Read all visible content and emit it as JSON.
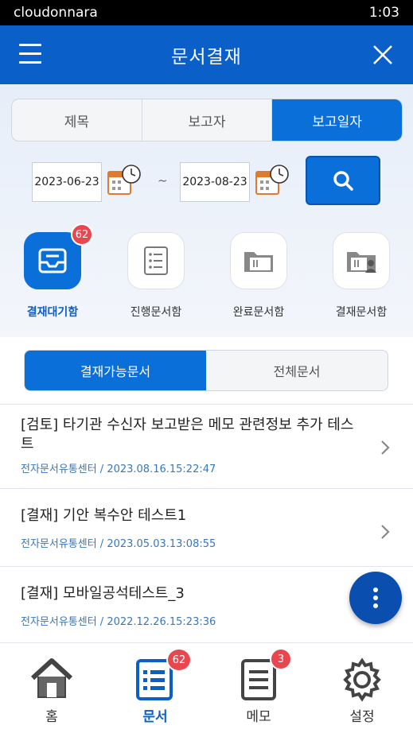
{
  "status_bar": {
    "app_name": "cloudonnara",
    "time": "1:03"
  },
  "header": {
    "title": "문서결재"
  },
  "search_tabs": [
    {
      "label": "제목",
      "active": false
    },
    {
      "label": "보고자",
      "active": false
    },
    {
      "label": "보고일자",
      "active": true
    }
  ],
  "date_range": {
    "start": "2023-06-23",
    "separator": "~",
    "end": "2023-08-23"
  },
  "doc_boxes": [
    {
      "label": "결재대기함",
      "badge": "62",
      "icon": "inbox-icon",
      "active": true
    },
    {
      "label": "진행문서함",
      "icon": "list-document-icon",
      "active": false
    },
    {
      "label": "완료문서함",
      "icon": "folder-icon",
      "active": false
    },
    {
      "label": "결재문서함",
      "icon": "folder-user-icon",
      "active": false
    }
  ],
  "filter_tabs": [
    {
      "label": "결재가능문서",
      "active": true
    },
    {
      "label": "전체문서",
      "active": false
    }
  ],
  "documents": [
    {
      "title": "[검토] 타기관 수신자 보고받은 메모 관련정보 추가 테스트",
      "meta": "전자문서유통센터 / 2023.08.16.15:22:47"
    },
    {
      "title": "[결재] 기안 복수안 테스트1",
      "meta": "전자문서유통센터 / 2023.05.03.13:08:55"
    },
    {
      "title": "[결재] 모바일공석테스트_3",
      "meta": "전자문서유통센터 / 2022.12.26.15:23:36"
    }
  ],
  "bottom_nav": [
    {
      "label": "홈",
      "icon": "home-icon",
      "active": false
    },
    {
      "label": "문서",
      "icon": "document-icon",
      "badge": "62",
      "active": true
    },
    {
      "label": "메모",
      "icon": "memo-icon",
      "badge": "3",
      "active": false
    },
    {
      "label": "설정",
      "icon": "gear-icon",
      "active": false
    }
  ],
  "colors": {
    "primary": "#0a5fc8",
    "accent": "#0a6fd8",
    "badge": "#e8474f",
    "meta_text": "#3a77b8"
  }
}
